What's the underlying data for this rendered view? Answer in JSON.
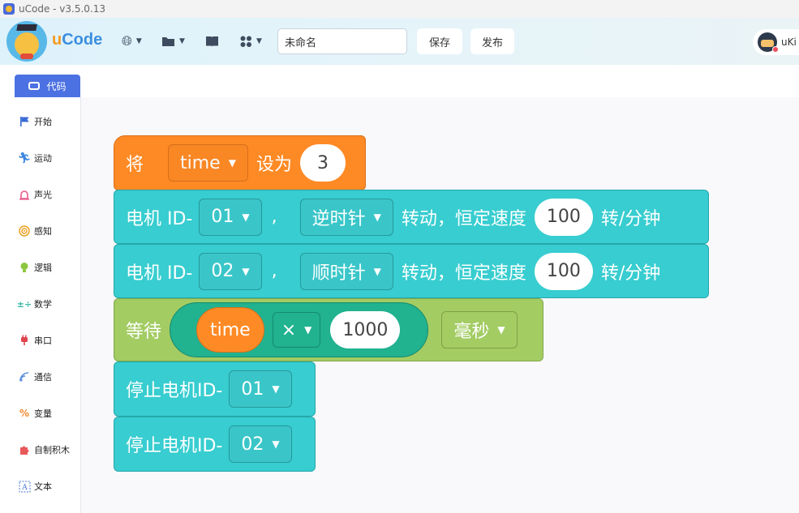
{
  "window": {
    "title": "uCode - v3.5.0.13"
  },
  "header": {
    "logo_text_u": "u",
    "logo_text_rest": "Code",
    "project_name": "未命名",
    "save_label": "保存",
    "publish_label": "发布",
    "user_name": "uKi"
  },
  "sidebar": {
    "tab_label": "代码",
    "categories": [
      {
        "label": "开始",
        "icon": "flag-icon",
        "color": "#3b6bd6"
      },
      {
        "label": "运动",
        "icon": "running-icon",
        "color": "#3c86e0"
      },
      {
        "label": "声光",
        "icon": "alarm-icon",
        "color": "#e85a8a"
      },
      {
        "label": "感知",
        "icon": "sensor-icon",
        "color": "#f0a020"
      },
      {
        "label": "逻辑",
        "icon": "bulb-icon",
        "color": "#8cc63f"
      },
      {
        "label": "数学",
        "icon": "math-icon",
        "color": "#35b6a0"
      },
      {
        "label": "串口",
        "icon": "plug-icon",
        "color": "#e0454f"
      },
      {
        "label": "通信",
        "icon": "antenna-icon",
        "color": "#5a8fdc"
      },
      {
        "label": "变量",
        "icon": "variable-icon",
        "color": "#f28a2e"
      },
      {
        "label": "自制积木",
        "icon": "puzzle-icon",
        "color": "#e85a5a"
      },
      {
        "label": "文本",
        "icon": "text-icon",
        "color": "#4a7ad8"
      }
    ]
  },
  "blocks": {
    "set_var": {
      "prefix": "将",
      "variable": "time",
      "middle": "设为",
      "value": "3"
    },
    "motor1": {
      "prefix": "电机 ID-",
      "id": "01",
      "comma": ",",
      "direction": "逆时针",
      "middle": "转动，恒定速度",
      "speed": "100",
      "unit": "转/分钟"
    },
    "motor2": {
      "prefix": "电机 ID-",
      "id": "02",
      "comma": ",",
      "direction": "顺时针",
      "middle": "转动，恒定速度",
      "speed": "100",
      "unit": "转/分钟"
    },
    "wait": {
      "prefix": "等待",
      "variable": "time",
      "operator": "×",
      "operand": "1000",
      "unit": "毫秒"
    },
    "stop1": {
      "prefix": "停止电机ID-",
      "id": "01"
    },
    "stop2": {
      "prefix": "停止电机ID-",
      "id": "02"
    }
  }
}
